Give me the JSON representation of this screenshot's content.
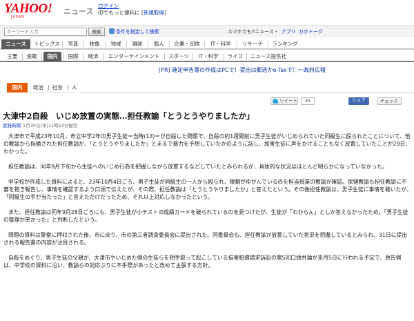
{
  "header": {
    "logo": "YAHOO!",
    "logo_sub": "JAPAN",
    "section": "ニュース",
    "login": "ログイン",
    "login_tagline": "IDでもっと便利に",
    "register": "新規取得"
  },
  "search": {
    "placeholder": "キーワード入力",
    "button": "検索",
    "options": "条件を指定して検索",
    "mobile_label": "スマホでもYニュース・",
    "links": [
      "アプリ",
      "カホトーク"
    ]
  },
  "main_nav": [
    "ニュース",
    "トピックス",
    "写真",
    "映像",
    "地域",
    "雑誌",
    "個人",
    "企業・団体",
    "IT・科学",
    "リサーチ",
    "ランキング"
  ],
  "sub_nav": [
    "主要",
    "速報",
    "国内",
    "国際",
    "経済",
    "エンターテインメント",
    "スポーツ",
    "IT・科学",
    "ライフ",
    "ニュース提供社"
  ],
  "pr_line": "[PR] 確定申告書の作成はPCで！提出は郵送かe-Taxで！～政府広報",
  "category_tabs": {
    "active": "国内",
    "items": [
      "政治",
      "社会",
      "人"
    ]
  },
  "share": {
    "tweet": "ツイート",
    "tweet_count": "35",
    "facebook": "シェア",
    "check": "チェック"
  },
  "article": {
    "headline": "大津中2自殺　いじめ放置の実態…担任教諭「とうとうやりましたか」",
    "source": "産経新聞",
    "datetime": "1月30日(水)11時14分配信",
    "paragraphs": [
      "大津市で平成23年10月、市立中学2年の男子生徒＝当時(13)＝が自殺した問題で、自殺の約1週間前に男子生徒がいじめられていた同級生に殴られたことについて、他の教諭から指摘された担任教諭が、「とうとうやりましたか」とまるで暴力を予想していたかのように話し、加害生徒に声をかけることもなく放置していたことが29日、わかった。",
      "担任教諭は、同年9月下旬から生徒へのいじめ行為を把握しながら放置するなどしていたとみられるが、具体的な状況はほとんど明らかになっていなかった。",
      "中学校が作成した資料によると、23年10月4日ごろ、男子生徒が同級生の一人から殴られ、眼鏡がゆがんでいるのを担当授業の教諭が確認。保健教諭も担任教諭に不審を抱き報告し、事情を確認するよう口頭で伝えたが、その際、担任教諭は「とうとうやりましたか」と答えたという。その後担任教諭は、男子生徒に事情を聴いたが、「同級生の手が当たった」と答えただけだったため、それ以上対応しなかったという。",
      "また、担任教諭は同年9月28日ごろにも、男子生徒が小テストの成績カードを破られているのを見つけたが、生徒が「わからん」としか答えなかったため、「男子生徒の整理が悪かった」と判断したという。",
      "問題の資料は警察に押収された後、市に戻り、市の第三者調査委員会に提出された。同委員会も、担任教諭が放置していた状況を把握しているとみられ、31日に提出される報告書の内容が注目される。",
      "自殺をめぐり、男子生徒の父親が、大津市やいじめた側の生徒らを相手取って起こしている損害賠償請求訴訟の第5回口頭弁論が来月5日に行われる予定で、原告側は、中学校の資料に沿い、教諭らの対応ぶりに不手際があったと改めて主張する方針。"
    ]
  },
  "colors": {
    "brand_red": "#e60012",
    "nav_active": "#5c5c5c",
    "tab_orange": "#e85a00",
    "link_blue": "#0033cc"
  }
}
